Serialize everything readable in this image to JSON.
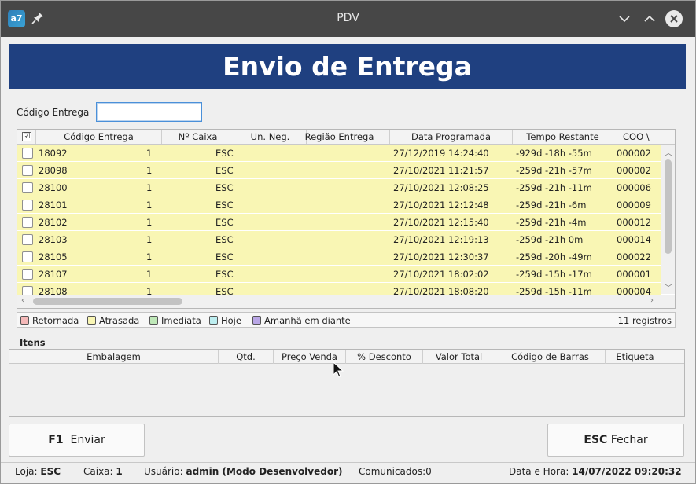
{
  "window": {
    "title": "PDV",
    "app_icon_text": "a7"
  },
  "banner": {
    "title": "Envio de Entrega"
  },
  "search": {
    "label": "Código Entrega",
    "value": "",
    "placeholder": ""
  },
  "grid": {
    "columns": [
      "Código Entrega",
      "Nº Caixa",
      "Un. Neg.",
      "Região Entrega",
      "Data Programada",
      "Tempo Restante",
      "COO \\"
    ],
    "header_checkbox": "☑",
    "rows": [
      {
        "codigo": "18092",
        "caixa": "1",
        "un_neg": "ESC",
        "regiao": "",
        "data": "27/12/2019 14:24:40",
        "tempo": "-929d -18h -55m",
        "coo": "000002"
      },
      {
        "codigo": "28098",
        "caixa": "1",
        "un_neg": "ESC",
        "regiao": "",
        "data": "27/10/2021 11:21:57",
        "tempo": "-259d -21h -57m",
        "coo": "000002"
      },
      {
        "codigo": "28100",
        "caixa": "1",
        "un_neg": "ESC",
        "regiao": "",
        "data": "27/10/2021 12:08:25",
        "tempo": "-259d -21h -11m",
        "coo": "000006"
      },
      {
        "codigo": "28101",
        "caixa": "1",
        "un_neg": "ESC",
        "regiao": "",
        "data": "27/10/2021 12:12:48",
        "tempo": "-259d -21h -6m",
        "coo": "000009"
      },
      {
        "codigo": "28102",
        "caixa": "1",
        "un_neg": "ESC",
        "regiao": "",
        "data": "27/10/2021 12:15:40",
        "tempo": "-259d -21h -4m",
        "coo": "000012"
      },
      {
        "codigo": "28103",
        "caixa": "1",
        "un_neg": "ESC",
        "regiao": "",
        "data": "27/10/2021 12:19:13",
        "tempo": "-259d -21h 0m",
        "coo": "000014"
      },
      {
        "codigo": "28105",
        "caixa": "1",
        "un_neg": "ESC",
        "regiao": "",
        "data": "27/10/2021 12:30:37",
        "tempo": "-259d -20h -49m",
        "coo": "000022"
      },
      {
        "codigo": "28107",
        "caixa": "1",
        "un_neg": "ESC",
        "regiao": "",
        "data": "27/10/2021 18:02:02",
        "tempo": "-259d -15h -17m",
        "coo": "000001"
      },
      {
        "codigo": "28108",
        "caixa": "1",
        "un_neg": "ESC",
        "regiao": "",
        "data": "27/10/2021 18:08:20",
        "tempo": "-259d -15h -11m",
        "coo": "000004"
      }
    ],
    "row_color": "#f9f6b4"
  },
  "legend": {
    "items": [
      {
        "label": "Retornada",
        "color": "#f4b8b8"
      },
      {
        "label": "Atrasada",
        "color": "#f9f6b4"
      },
      {
        "label": "Imediata",
        "color": "#bfe8b8"
      },
      {
        "label": "Hoje",
        "color": "#bdeef0"
      },
      {
        "label": "Amanhã em diante",
        "color": "#b9a6e6"
      }
    ],
    "count": "11 registros"
  },
  "itens": {
    "label": "Itens",
    "columns": [
      "Embalagem",
      "Qtd.",
      "Preço Venda",
      "% Desconto",
      "Valor Total",
      "Código de Barras",
      "Etiqueta"
    ]
  },
  "buttons": {
    "enviar_key": "F1",
    "enviar_label": "Enviar",
    "fechar_key": "ESC",
    "fechar_label": "Fechar"
  },
  "status": {
    "loja_label": "Loja:",
    "loja_value": "ESC",
    "caixa_label": "Caixa:",
    "caixa_value": "1",
    "usuario_label": "Usuário:",
    "usuario_value": "admin (Modo Desenvolvedor)",
    "comunicados": "Comunicados:0",
    "datahora_label": "Data e Hora:",
    "datahora_value": "14/07/2022 09:20:32"
  },
  "colors": {
    "banner": "#1f4080",
    "titlebar": "#474747"
  }
}
